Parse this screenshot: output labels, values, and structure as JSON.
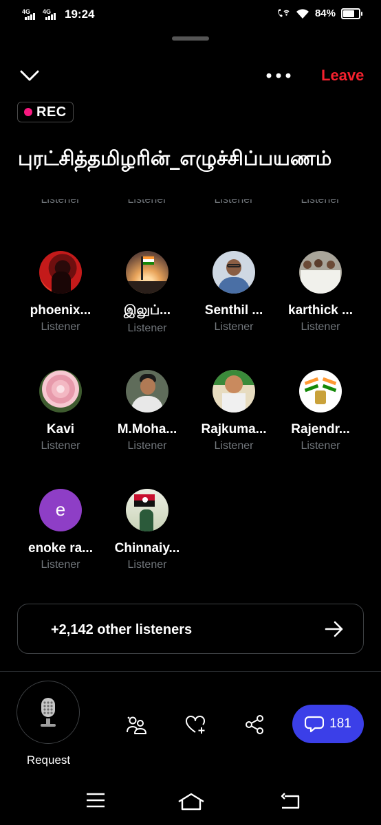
{
  "status_bar": {
    "network_1": "4G",
    "network_2": "4G",
    "time": "19:24",
    "battery": "84%"
  },
  "header": {
    "leave_label": "Leave",
    "rec_label": "REC"
  },
  "space": {
    "title": "புரட்சித்தமிழரின்_எழுச்சிப்பயணம்"
  },
  "partial_row": [
    {
      "role": "Listener"
    },
    {
      "role": "Listener"
    },
    {
      "role": "Listener"
    },
    {
      "role": "Listener"
    }
  ],
  "listeners": [
    {
      "name": "phoenix...",
      "role": "Listener",
      "avatar": "red-portrait"
    },
    {
      "name": "இலுப்...",
      "role": "Listener",
      "avatar": "flag-sunset"
    },
    {
      "name": "Senthil ...",
      "role": "Listener",
      "avatar": "man-glasses"
    },
    {
      "name": "karthick ...",
      "role": "Listener",
      "avatar": "group-photo"
    },
    {
      "name": "Kavi",
      "role": "Listener",
      "avatar": "pink-rose"
    },
    {
      "name": "M.Moha...",
      "role": "Listener",
      "avatar": "young-man"
    },
    {
      "name": "Rajkuma...",
      "role": "Listener",
      "avatar": "poster-52"
    },
    {
      "name": "Rajendr...",
      "role": "Listener",
      "avatar": "india-emblem"
    },
    {
      "name": "enoke ra...",
      "role": "Listener",
      "avatar": "letter-e",
      "initial": "e"
    },
    {
      "name": "Chinnaiy...",
      "role": "Listener",
      "avatar": "flag-raiser"
    }
  ],
  "other_listeners": "+2,142 other listeners",
  "bottom_bar": {
    "request_label": "Request",
    "comment_count": "181"
  },
  "colors": {
    "leave": "#f4212e",
    "rec_dot": "#f91880",
    "comments_button": "#3b3fe8",
    "muted_text": "#71767b"
  }
}
